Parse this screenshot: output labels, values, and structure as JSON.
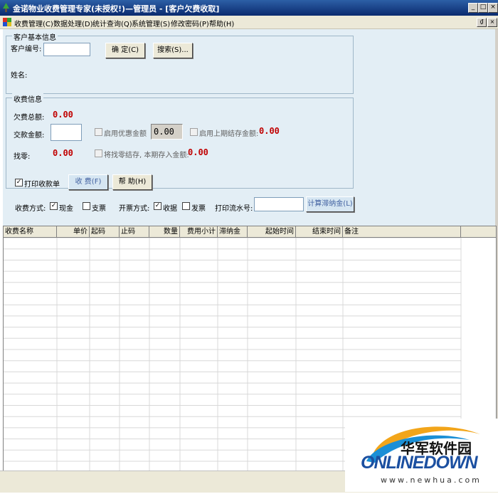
{
  "window": {
    "title": "金诺物业收费管理专家(未授权!)—管理员 - [客户欠费收取]",
    "minimize": "_",
    "maximize": "□",
    "close": "×",
    "mdi_restore": "₫",
    "mdi_close": "×"
  },
  "menu": [
    "收费管理(C)",
    "数据处理(D)",
    "统计查询(Q)",
    "系统管理(S)",
    "修改密码(P)",
    "帮助(H)"
  ],
  "customer": {
    "group_title": "客户基本信息",
    "id_label": "客户编号:",
    "id_value": "",
    "confirm_button": "确 定(C)",
    "search_button": "搜索(S)...",
    "name_label": "姓名:"
  },
  "charge": {
    "group_title": "收费信息",
    "total_owed_label": "欠费总额:",
    "total_owed_value": "0.00",
    "pay_amount_label": "交款金额:",
    "pay_amount_value": "",
    "discount_label": "启用优惠金额",
    "discount_value": "0.00",
    "prev_balance_label": "启用上期结存金额:",
    "prev_balance_value": "0.00",
    "change_label": "找零:",
    "change_value": "0.00",
    "carry_label": "将找零结存, 本期存入金额:",
    "carry_value": "0.00",
    "print_receipt_label": "打印收款单",
    "print_receipt_checked": "✓",
    "collect_button": "收 费(F)",
    "help_button": "帮   助(H)"
  },
  "payment": {
    "method_label": "收费方式:",
    "cash_label": "现金",
    "cash_checked": "✓",
    "check_label": "支票",
    "invoice_label": "开票方式:",
    "receipt_label": "收据",
    "receipt_checked": "✓",
    "fapiao_label": "发票",
    "serial_label": "打印流水号:",
    "serial_value": "",
    "late_fee_button": "计算滞纳金(L)"
  },
  "grid": {
    "columns": [
      "收费名称",
      "单价",
      "起码",
      "止码",
      "数量",
      "费用小计",
      "滞纳金",
      "起始时间",
      "结束时间",
      "备注"
    ]
  },
  "logo": {
    "cn": "华军软件园",
    "en": "ONLINEDOWN",
    "url": "www.newhua.com"
  }
}
